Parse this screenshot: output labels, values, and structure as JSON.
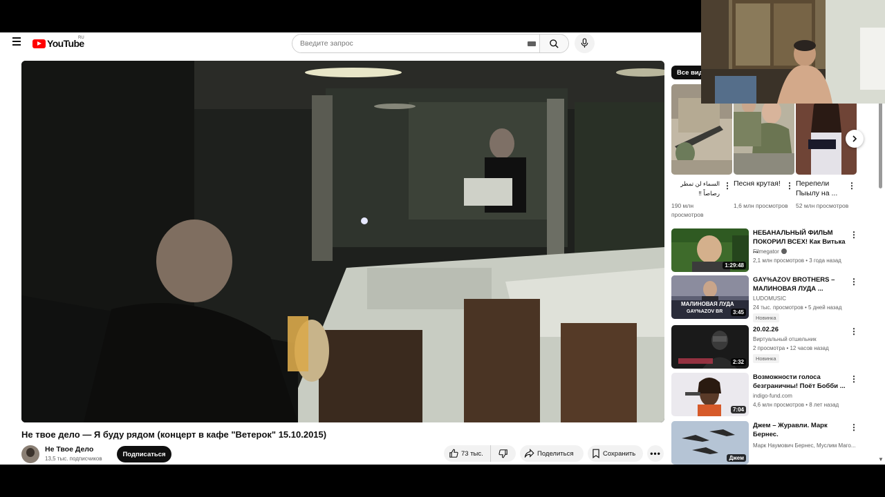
{
  "header": {
    "logo_text": "YouTube",
    "country_code": "RU",
    "search_placeholder": "Введите запрос"
  },
  "video": {
    "title": "Не твое дело — Я буду рядом (концерт в кафе \"Ветерок\" 15.10.2015)",
    "channel_name": "Не Твое Дело",
    "subscribers": "13,5 тыс. подписчиков",
    "subscribe_label": "Подписаться",
    "likes": "73 тыс.",
    "share_label": "Поделиться",
    "save_label": "Сохранить",
    "more_label": "•••"
  },
  "sidebar": {
    "filter_chip": "Все вид",
    "shorts": [
      {
        "title": "السماء لن تمطر رصاصاً !!",
        "views": "190 млн просмотров"
      },
      {
        "title": "Песня крутая!",
        "views": "1,6 млн просмотров"
      },
      {
        "title": "Перепели Пыылу на ...",
        "views": "52 млн просмотров"
      }
    ],
    "recommendations": [
      {
        "title": "НЕБАНАЛЬНЫЙ ФИЛЬМ ПОКОРИЛ ВСЕХ! Как Витька ...",
        "channel": "Filmegator",
        "meta": "2,1 млн просмотров • 3 года назад",
        "duration": "1:29:48",
        "badge": ""
      },
      {
        "title": "GAY%AZOV BROTHERS – МАЛИНОВАЯ ЛУДА ...",
        "channel": "LUDOMUSIC",
        "meta": "24 тыс. просмотров • 5 дней назад",
        "duration": "3:45",
        "badge": "Новинка",
        "thumb_text": "МАЛИНОВАЯ ЛУДА",
        "thumb_sub": "GAY%AZOV BR"
      },
      {
        "title": "20.02.26",
        "channel": "Виртуальный отшельник",
        "meta": "2 просмотра • 12 часов назад",
        "duration": "2:32",
        "badge": "Новинка"
      },
      {
        "title": "Возможности голоса безграничны! Поёт Бобби ...",
        "channel": "indigo-fund.com",
        "meta": "4,6 млн просмотров • 8 лет назад",
        "duration": "7:04",
        "badge": ""
      },
      {
        "title": "Джем – Журавли. Марк Бернес.",
        "channel": "Марк Наумович Бернес, Муслим Маго...",
        "meta": "",
        "duration": "Джем",
        "badge": ""
      }
    ]
  },
  "colors": {
    "brand_red": "#ff0000",
    "text_primary": "#0f0f0f",
    "text_secondary": "#606060",
    "chip_bg": "#f2f2f2"
  },
  "icons": [
    "menu-icon",
    "youtube-logo-icon",
    "keyboard-icon",
    "search-icon",
    "mic-icon",
    "like-icon",
    "dislike-icon",
    "share-icon",
    "save-icon",
    "more-icon",
    "chevron-right-icon",
    "kebab-menu-icon",
    "verified-icon"
  ]
}
